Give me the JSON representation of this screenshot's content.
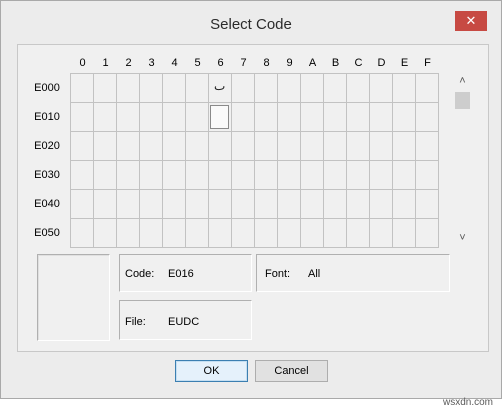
{
  "window": {
    "title": "Select Code",
    "close_glyph": "✕"
  },
  "grid": {
    "columns": [
      "0",
      "1",
      "2",
      "3",
      "4",
      "5",
      "6",
      "7",
      "8",
      "9",
      "A",
      "B",
      "C",
      "D",
      "E",
      "F"
    ],
    "rows": [
      "E000",
      "E010",
      "E020",
      "E030",
      "E040",
      "E050"
    ],
    "filled_cell_glyph": "ٮ",
    "selected_code": "E016"
  },
  "scrollbar": {
    "up_arrow": "˄",
    "down_arrow": "˅"
  },
  "info": {
    "code_label": "Code:",
    "code_value": "E016",
    "font_label": "Font:",
    "font_value": "All",
    "file_label": "File:",
    "file_value": "EUDC"
  },
  "buttons": {
    "ok": "OK",
    "cancel": "Cancel"
  },
  "watermark": "wsxdn.com",
  "colors": {
    "close_button": "#c74a43",
    "ok_border": "#3c7fb1",
    "dialog_bg": "#f0f0f0"
  }
}
